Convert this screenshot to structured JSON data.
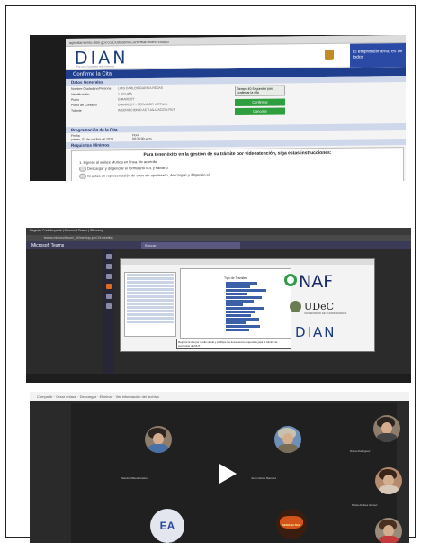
{
  "photo1": {
    "browser_url": "agendamiento.dian.gov.co/Ciudadano/Confirmar/Index?codigo",
    "logo": "DIAN",
    "logo_sub": "Por una Colombia más honesta",
    "gov_banner": "El emprendimiento es de todos",
    "page_title": "Confirme la Cita",
    "datos_title": "Datos Generales",
    "datos_rows": [
      {
        "k": "Nombre Ciudadano/Persona",
        "v": "LUIS CARLOS GARCIA ROJAS"
      },
      {
        "k": "Identificación",
        "v": "1.023.466"
      },
      {
        "k": "Punto",
        "v": "GIRARDOT"
      },
      {
        "k": "Punto de Contacto",
        "v": "GIRARDOT - SERVIDOR VIRTUAL"
      },
      {
        "k": "Trámite",
        "v": "INSCRIPCION O ACTUALIZACION RUT"
      }
    ],
    "timer_text": "Tiempo 40 Segundos para confirmar la cita",
    "btn_confirm": "Confirmar",
    "btn_cancel": "Cancelar",
    "prog_title": "Programación de la Cita",
    "prog_headers": [
      "Fecha",
      "Hora"
    ],
    "prog_values": [
      "jueves, 02 de octubre de 2023",
      "09:30:00 a. m."
    ],
    "req_title": "Requisitos Mínimos",
    "req_headline": "Para tener éxito en la gestión de su trámite por videoatención, siga estas instrucciones:",
    "req_items": [
      "1. Ingrese al enlace Muisca en línea, de acuerdo",
      "Descargar y diligenciar el formulario 001 y salvarlo",
      "Si actúa en representación de otros sin apoderado, descargue y diligencie el"
    ]
  },
  "photo2": {
    "tab_text": "Registro Contribuyente  |  Microsoft Teams  |  iPhoneap",
    "url_text": "teams.microsoft.com/_#/l/meetup-join/19:meeting",
    "teams_title": "Microsoft Teams",
    "search_placeholder": "Buscar",
    "chart_title": "Tipo de Trámites",
    "bar_levels": [
      0.55,
      0.42,
      0.7,
      0.38,
      0.62,
      0.48,
      0.3,
      0.66,
      0.52,
      0.44,
      0.58,
      0.36,
      0.6,
      0.4
    ],
    "logo_naf": "NAF",
    "logo_udec": "UDeC",
    "udec_sub": "UNIVERSIDAD DE CUNDINAMARCA",
    "logo_dian": "DIAN",
    "note_text": "Registre la cita por medio virtual y verifique los documentos requeridos para el trámite de inscripción del RUT."
  },
  "photo3": {
    "status_text": "Compartir  ·  Crear enlace  ·  Descargar  ·  Eliminar  ·  Ver información del archivo",
    "initials": "EA",
    "poster_text": "SEMANA NAF",
    "captions": [
      "Sandra Milena Castro",
      "Juan Carlos Ramírez",
      "Diana Rodríguez",
      "Paula Andrea Gómez"
    ]
  },
  "colors": {
    "dian_blue": "#1b3d7a",
    "confirm_green": "#2f9e3e",
    "teams_purple": "#3b3a57",
    "naf_green": "#2d9c4a"
  }
}
